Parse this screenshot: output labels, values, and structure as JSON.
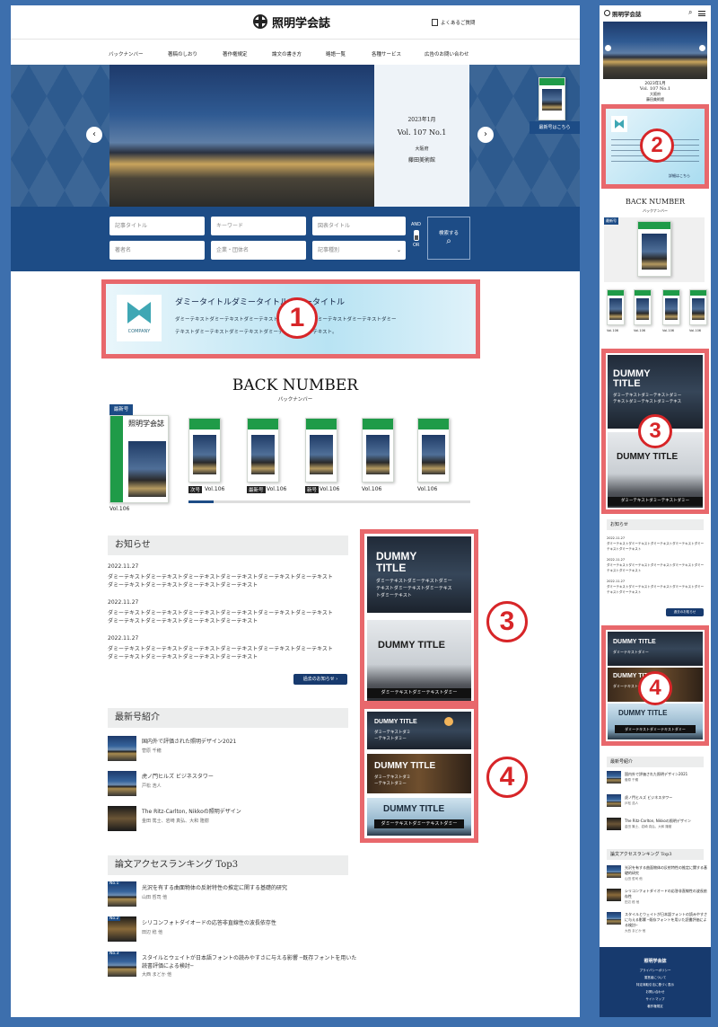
{
  "site": {
    "title": "照明学会誌",
    "faq": "よくあるご質問"
  },
  "nav": [
    "バックナンバー",
    "著稿のしおり",
    "著作権規定",
    "論文の書き方",
    "略語一覧",
    "各種サービス",
    "広告のお問い合わせ"
  ],
  "hero": {
    "date": "2023年1月",
    "volume": "Vol. 107 No.1",
    "location": "大阪府",
    "building": "藤田美術館",
    "latest_link": "最新号はこちら"
  },
  "search": {
    "field1": "記事タイトル",
    "field2": "キーワード",
    "field3": "図表タイトル",
    "field4": "著者名",
    "field5": "企業・団体名",
    "select": "記事種別",
    "and": "AND",
    "or": "OR",
    "button": "検索する"
  },
  "banner": {
    "logo_text": "COMPANY",
    "title": "ダミータイトルダミータイトルダミータイトル",
    "body1": "ダミーテキストダミーテキストダミーテキストダミーテキストダミーテキストダミーテキストダミー",
    "body2": "テキストダミーテキストダミーテキストダミーテキストダミーテキスト。"
  },
  "backnumber": {
    "title": "BACK NUMBER",
    "subtitle": "バックナンバー",
    "latest_badge": "最新号",
    "cover_title": "照明学会誌",
    "main_vol": "Vol.106",
    "items": [
      {
        "tag": "次号",
        "vol": "Vol.106"
      },
      {
        "tag": "最新号",
        "vol": "Vol.106"
      },
      {
        "tag": "新号",
        "vol": "Vol.106"
      },
      {
        "tag": "",
        "vol": "Vol.106"
      },
      {
        "tag": "",
        "vol": "Vol.106"
      }
    ]
  },
  "news": {
    "title": "お知らせ",
    "items": [
      {
        "date": "2022.11.27",
        "line1": "ダミーテキストダミーテキストダミーテキストダミーテキストダミーテキストダミーテキスト",
        "line2": "ダミーテキストダミーテキストダミーテキストダミーテキスト"
      },
      {
        "date": "2022.11.27",
        "line1": "ダミーテキストダミーテキストダミーテキストダミーテキストダミーテキストダミーテキスト",
        "line2": "ダミーテキストダミーテキストダミーテキストダミーテキスト"
      },
      {
        "date": "2022.11.27",
        "line1": "ダミーテキストダミーテキストダミーテキストダミーテキストダミーテキストダミーテキスト",
        "line2": "ダミーテキストダミーテキストダミーテキストダミーテキスト"
      }
    ],
    "more": "過去のお知らせ"
  },
  "latest": {
    "title": "最新号紹介",
    "items": [
      {
        "title": "国内外で評価された照明デザイン2021",
        "author": "菅原 千穂"
      },
      {
        "title": "虎ノ門ヒルズ ビジネスタワー",
        "author": "戸松 浩人"
      },
      {
        "title": "The Ritz-Carlton, Nikkoの照明デザイン",
        "author": "金田 篤士、岩崎 真弘、大和 隆樹"
      }
    ]
  },
  "ranking": {
    "title": "論文アクセスランキング Top3",
    "items": [
      {
        "rank": "No.1",
        "title": "光沢を有する曲面物体の反射特性の推定に関する基礎的研究",
        "author": "山田 哲司 他"
      },
      {
        "rank": "No.2",
        "title": "シリコンフォトダイオードの応答非直線性の波長依存性",
        "author": "田辺 稔 他"
      },
      {
        "rank": "No.3",
        "title": "スタイルとウェイトが日本語フォントの読みやすさに与える影響 ─既存フォントを用いた読書評価による検討─",
        "author": "大西 まどか 他"
      }
    ]
  },
  "ads3": {
    "title1a": "DUMMY",
    "title1b": "TITLE",
    "text1a": "ダミーテキストダミーテキストダミー",
    "text1b": "テキストダミーテキストダミーテキス",
    "text1c": "トダミーテキスト",
    "title2": "DUMMY TITLE",
    "text2": "ダミーテキストダミーテキストダミー"
  },
  "ads4": {
    "title1": "DUMMY TITLE",
    "text1a": "ダミーテキストダミ",
    "text1b": "ーテキストダミー",
    "title2": "DUMMY TITLE",
    "text2a": "ダミーテキストダミ",
    "text2b": "ーテキストダミー",
    "title3": "DUMMY TITLE",
    "text3": "ダミーテキストダミーテキストダミー"
  },
  "ads4m": {
    "title1": "DUMMY TITLE",
    "text1": "ダミーテキストダミー",
    "title2": "DUMMY TITLE",
    "text2": "ダミーテキストダミー"
  },
  "ads3m": {
    "text": "ダミーテキストダミーテキストダミー"
  },
  "mobile": {
    "date": "2023年1月",
    "volume": "Vol. 107 No.1",
    "location": "大阪府",
    "building": "藤田美術館",
    "more": "詳細はこちら",
    "news_more": "過去のお知らせ",
    "footer_title": "照明学会誌",
    "footer_links": [
      "プライバシーポリシー",
      "運営者について",
      "特定商取引法に基づく表示",
      "お問い合わせ",
      "サイトマップ",
      "著作権規定"
    ]
  },
  "markers": {
    "m1": "1",
    "m2": "2",
    "m3": "3",
    "m4": "4"
  }
}
